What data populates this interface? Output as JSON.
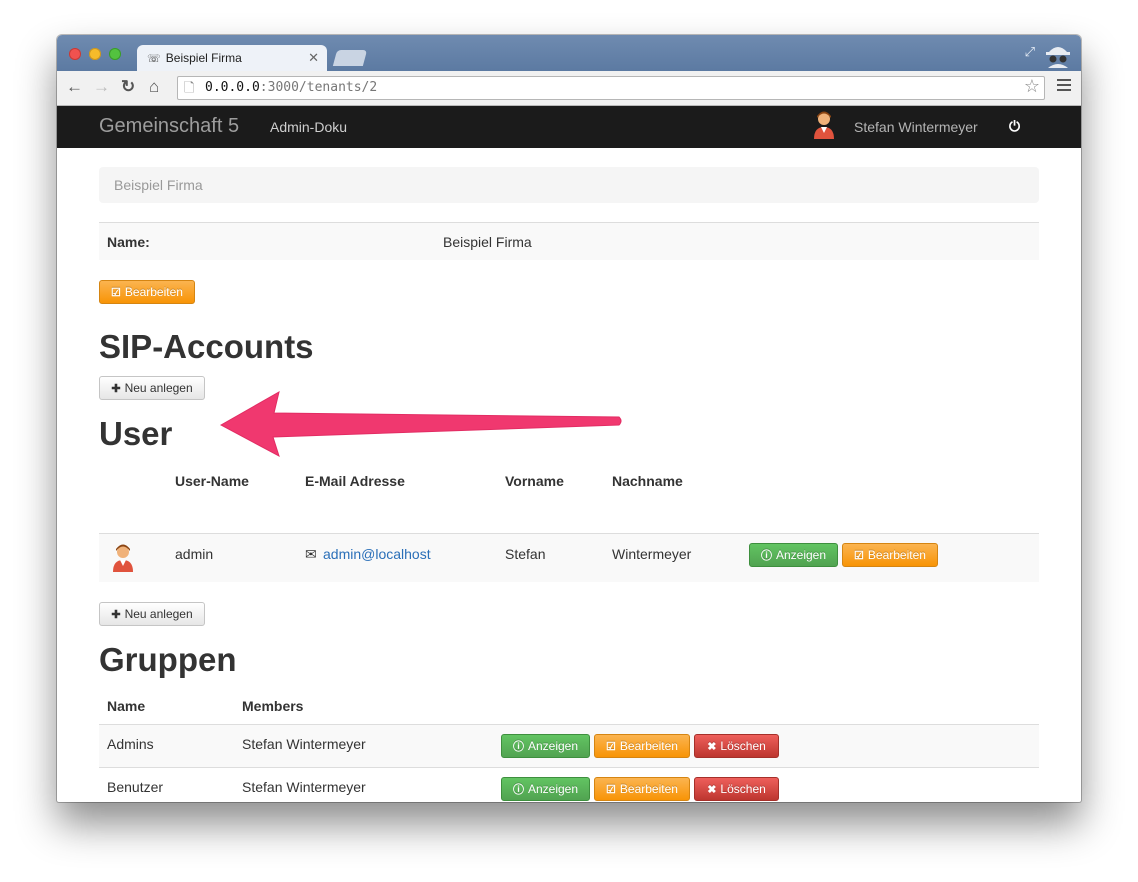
{
  "browser": {
    "tab_title": "Beispiel Firma",
    "url_host": "0.0.0.0",
    "url_rest": ":3000/tenants/2"
  },
  "navbar": {
    "brand": "Gemeinschaft 5",
    "link": "Admin-Doku",
    "user_name": "Stefan Wintermeyer"
  },
  "breadcrumb": "Beispiel Firma",
  "tenant": {
    "name_label": "Name:",
    "name_value": "Beispiel Firma",
    "edit_label": "Bearbeiten"
  },
  "sip": {
    "heading": "SIP-Accounts",
    "new_label": "Neu anlegen"
  },
  "users": {
    "heading": "User",
    "columns": [
      "User-Name",
      "E-Mail Adresse",
      "Vorname",
      "Nachname"
    ],
    "rows": [
      {
        "username": "admin",
        "email": "admin@localhost",
        "first": "Stefan",
        "last": "Wintermeyer",
        "show": "Anzeigen",
        "edit": "Bearbeiten"
      }
    ],
    "new_label": "Neu anlegen"
  },
  "groups": {
    "heading": "Gruppen",
    "columns": [
      "Name",
      "Members"
    ],
    "rows": [
      {
        "name": "Admins",
        "members": "Stefan Wintermeyer",
        "show": "Anzeigen",
        "edit": "Bearbeiten",
        "delete": "Löschen"
      },
      {
        "name": "Benutzer",
        "members": "Stefan Wintermeyer",
        "show": "Anzeigen",
        "edit": "Bearbeiten",
        "delete": "Löschen"
      }
    ]
  },
  "colors": {
    "annotation_arrow": "#f0386f",
    "warning": "#f89406",
    "success": "#51a351",
    "danger": "#bd362f",
    "navbar": "#1b1b1b"
  },
  "icons": [
    "incognito-icon",
    "expand-icon",
    "back-icon",
    "forward-icon",
    "reload-icon",
    "home-icon",
    "document-icon",
    "star-icon",
    "menu-icon",
    "avatar",
    "power-icon",
    "edit-icon",
    "plus-icon",
    "envelope-icon",
    "info-icon",
    "remove-icon"
  ]
}
